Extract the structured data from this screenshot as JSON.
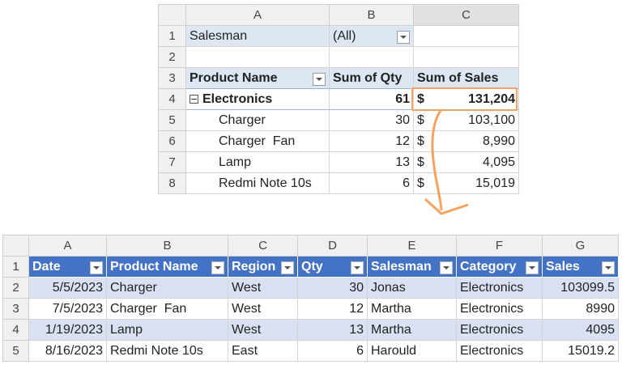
{
  "pivot": {
    "columns": [
      "A",
      "B",
      "C"
    ],
    "rows": [
      "1",
      "2",
      "3",
      "4",
      "5",
      "6",
      "7",
      "8"
    ],
    "filter_label": "Salesman",
    "filter_value": "(All)",
    "headers": [
      "Product Name",
      "Sum of Qty",
      "Sum of Sales"
    ],
    "group": {
      "label": "Electronics",
      "qty": "61",
      "currency": "$",
      "sales": "131,204"
    },
    "items": [
      {
        "name": "Charger",
        "qty": "30",
        "currency": "$",
        "sales": "103,100"
      },
      {
        "name": "Charger  Fan",
        "qty": "12",
        "currency": "$",
        "sales": "8,990"
      },
      {
        "name": "Lamp",
        "qty": "13",
        "currency": "$",
        "sales": "4,095"
      },
      {
        "name": "Redmi Note 10s",
        "qty": "6",
        "currency": "$",
        "sales": "15,019"
      }
    ]
  },
  "source": {
    "columns": [
      "A",
      "B",
      "C",
      "D",
      "E",
      "F",
      "G"
    ],
    "rows": [
      "1",
      "2",
      "3",
      "4",
      "5"
    ],
    "headers": [
      "Date",
      "Product Name",
      "Region",
      "Qty",
      "Salesman",
      "Category",
      "Sales"
    ],
    "data": [
      [
        "5/5/2023",
        "Charger",
        "West",
        "30",
        "Jonas",
        "Electronics",
        "103099.5"
      ],
      [
        "7/5/2023",
        "Charger  Fan",
        "West",
        "12",
        "Martha",
        "Electronics",
        "8990"
      ],
      [
        "1/19/2023",
        "Lamp",
        "West",
        "13",
        "Martha",
        "Electronics",
        "4095"
      ],
      [
        "8/16/2023",
        "Redmi Note 10s",
        "East",
        "6",
        "Harould",
        "Electronics",
        "15019.2"
      ]
    ]
  },
  "colors": {
    "header_blue": "#4472c4",
    "band_blue": "#d9e1f2",
    "pivot_header": "#dde7f4",
    "highlight": "#f4a460"
  }
}
